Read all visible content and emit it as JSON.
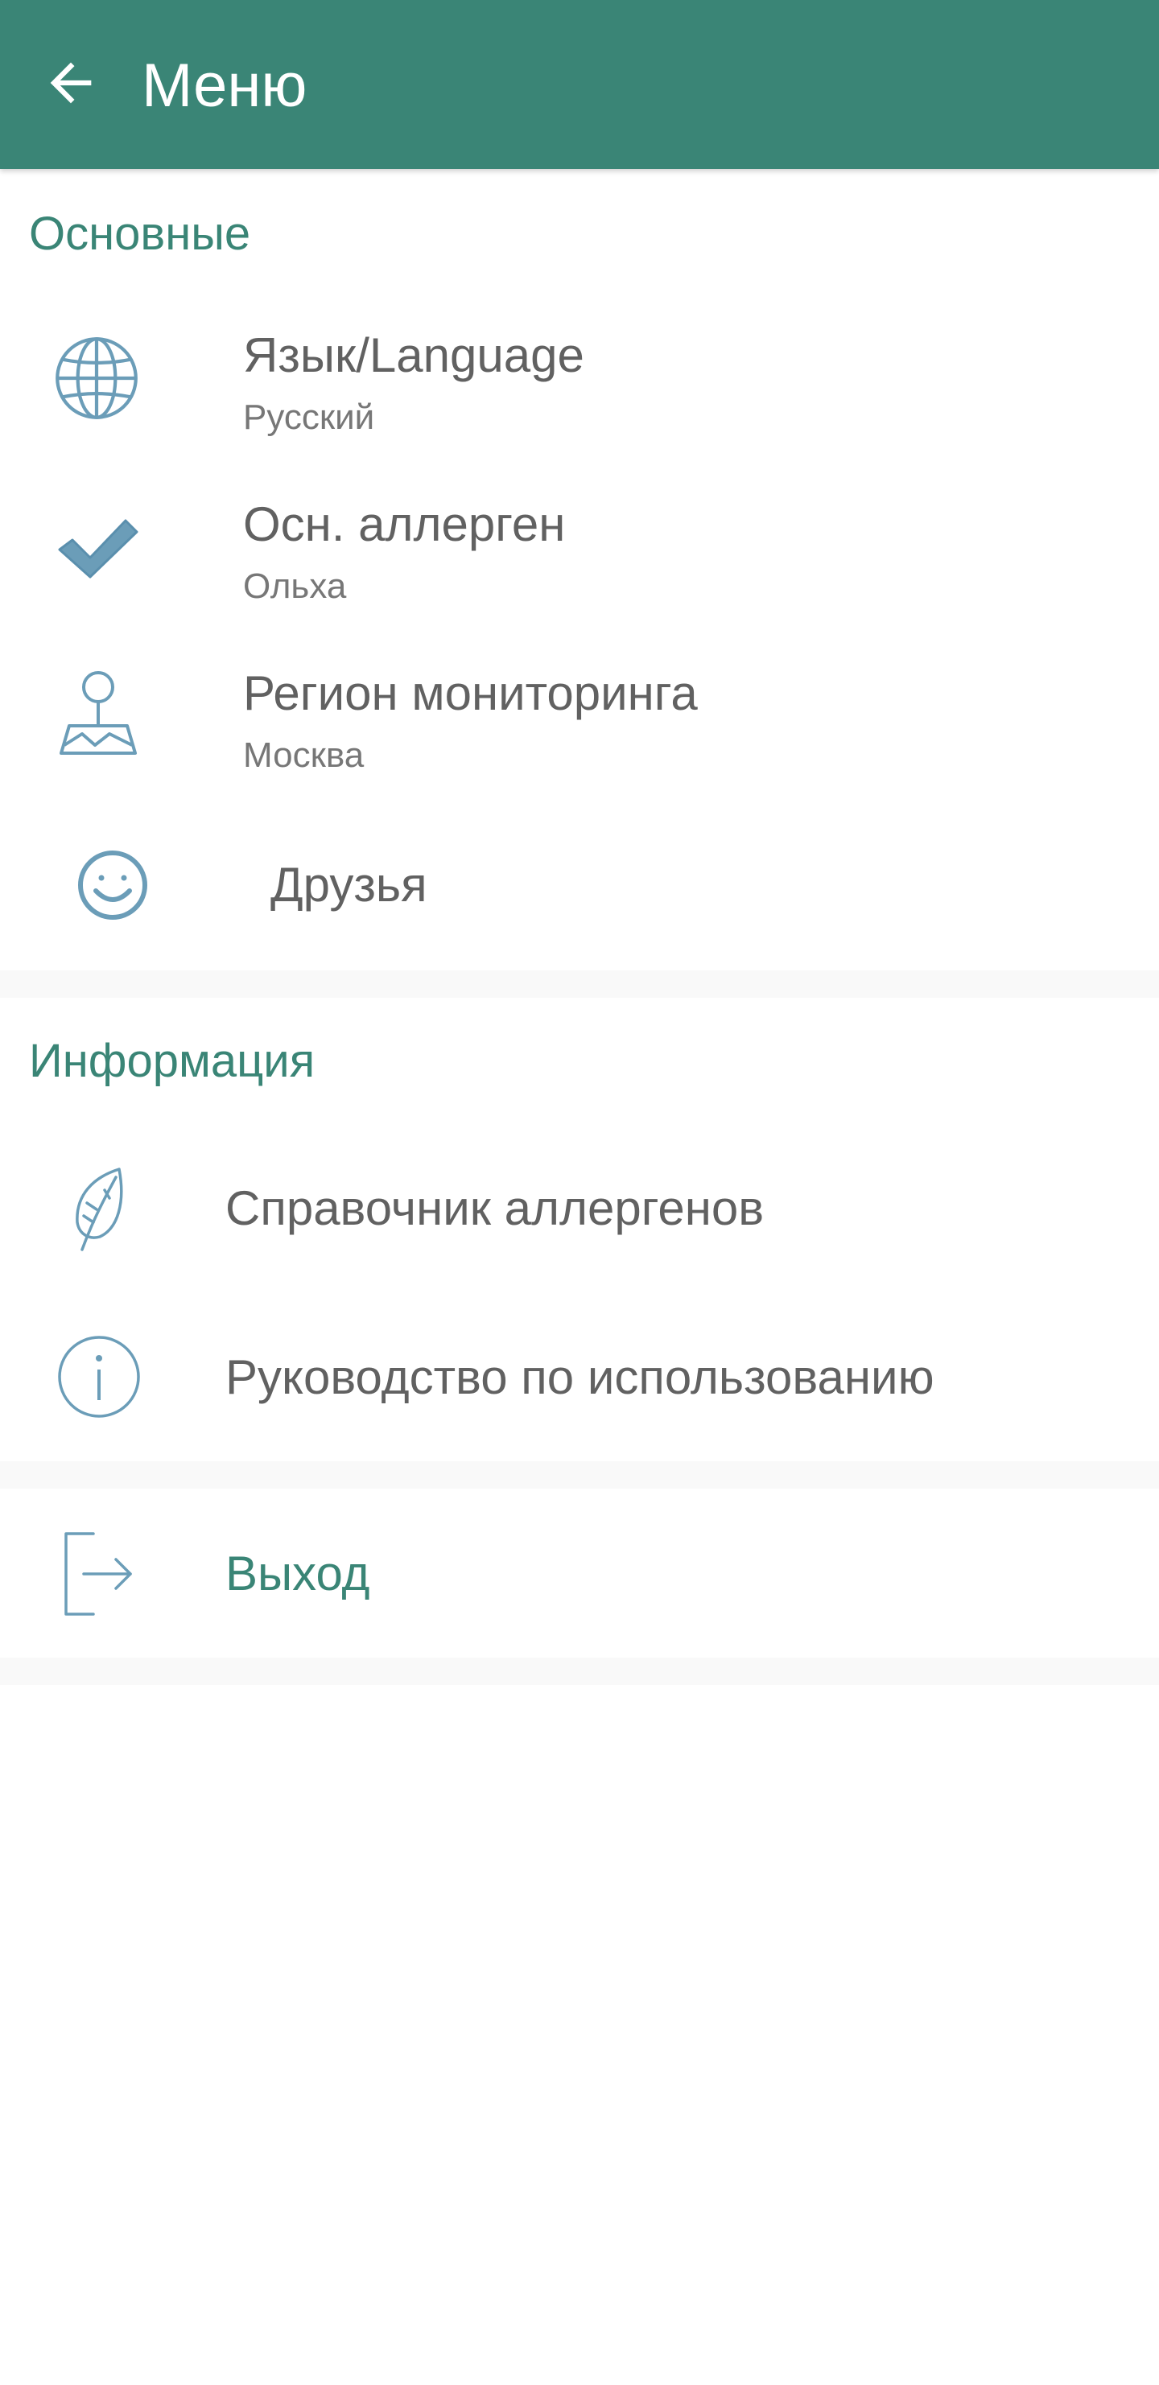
{
  "colors": {
    "primary": "#3a8576",
    "accent": "#3a8576",
    "icon": "#6b9db8",
    "text": "#616161",
    "subtext": "#777777"
  },
  "appbar": {
    "title": "Меню",
    "back_icon": "arrow-left-icon"
  },
  "sections": {
    "main": {
      "title": "Основные",
      "items": [
        {
          "icon": "globe-icon",
          "title": "Язык/Language",
          "subtitle": "Русский"
        },
        {
          "icon": "checkmark-icon",
          "title": "Осн. аллерген",
          "subtitle": "Ольха"
        },
        {
          "icon": "map-pin-icon",
          "title": "Регион мониторинга",
          "subtitle": "Москва"
        },
        {
          "icon": "smiley-icon",
          "title": "Друзья"
        }
      ]
    },
    "info": {
      "title": "Информация",
      "items": [
        {
          "icon": "leaf-icon",
          "title": "Справочник аллергенов"
        },
        {
          "icon": "info-icon",
          "title": "Руководство по использованию"
        }
      ]
    },
    "exit": {
      "items": [
        {
          "icon": "logout-icon",
          "title": "Выход"
        }
      ]
    }
  }
}
